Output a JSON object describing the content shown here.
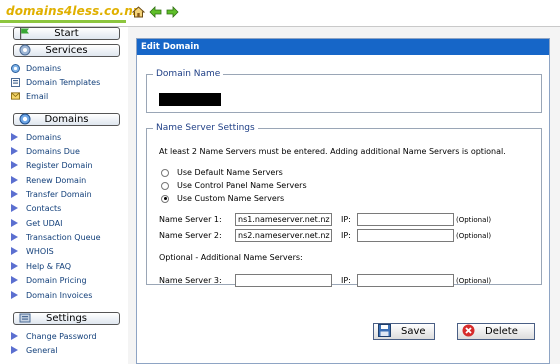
{
  "header": {
    "logo": "domains4less.co.nz",
    "icons": [
      "home-icon",
      "back-arrow-icon",
      "forward-arrow-icon"
    ]
  },
  "sidebar": {
    "start_label": "Start",
    "services_label": "Services",
    "services_items": [
      {
        "label": "Domains",
        "icon": "globe-icon"
      },
      {
        "label": "Domain Templates",
        "icon": "template-icon"
      },
      {
        "label": "Email",
        "icon": "envelope-icon"
      }
    ],
    "domains_label": "Domains",
    "domains_items": [
      "Domains",
      "Domains Due",
      "Register Domain",
      "Renew Domain",
      "Transfer Domain",
      "Contacts",
      "Get UDAI",
      "Transaction Queue",
      "WHOIS",
      "Help & FAQ",
      "Domain Pricing",
      "Domain Invoices"
    ],
    "settings_label": "Settings",
    "settings_items": [
      "Change Password",
      "General"
    ]
  },
  "panel": {
    "title": "Edit Domain",
    "domain_name_legend": "Domain Name",
    "ns_legend": "Name Server Settings",
    "info": "At least 2 Name Servers must be entered. Adding additional Name Servers is optional.",
    "radios": [
      {
        "label": "Use Default Name Servers",
        "checked": false
      },
      {
        "label": "Use Control Panel Name Servers",
        "checked": false
      },
      {
        "label": "Use Custom Name Servers",
        "checked": true
      }
    ],
    "ns1_label": "Name Server 1:",
    "ns1_value": "ns1.nameserver.net.nz",
    "ns2_label": "Name Server 2:",
    "ns2_value": "ns2.nameserver.net.nz",
    "ip_label": "IP:",
    "optional": "(Optional)",
    "additional_label": "Optional - Additional Name Servers:",
    "ns3_label": "Name Server 3:",
    "save_label": "Save",
    "delete_label": "Delete"
  },
  "colors": {
    "header_blue": "#1666c8",
    "logo_yellow": "#e0b000",
    "link_blue": "#123f7a"
  }
}
